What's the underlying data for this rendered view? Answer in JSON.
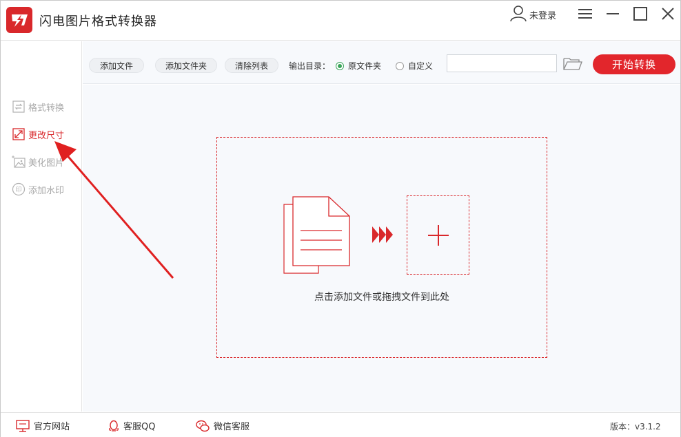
{
  "app": {
    "title": "闪电图片格式转换器"
  },
  "user": {
    "label": "未登录"
  },
  "sidebar": {
    "items": [
      {
        "label": "格式转换"
      },
      {
        "label": "更改尺寸"
      },
      {
        "label": "美化图片"
      },
      {
        "label": "添加水印"
      }
    ]
  },
  "toolbar": {
    "add_file": "添加文件",
    "add_folder": "添加文件夹",
    "clear_list": "清除列表",
    "output_label": "输出目录：",
    "option_original": "原文件夹",
    "option_custom": "自定义",
    "path_value": "",
    "start": "开始转换"
  },
  "main": {
    "drop_hint": "点击添加文件或拖拽文件到此处"
  },
  "footer": {
    "website": "官方网站",
    "qq": "客服QQ",
    "wechat": "微信客服",
    "version": "版本：v3.1.2"
  },
  "colors": {
    "accent": "#d9282b",
    "radio_checked": "#3aa55a",
    "background": "#f7f9fc"
  },
  "icons": [
    "logo-icon",
    "user-icon",
    "menu-icon",
    "minimize-icon",
    "maximize-icon",
    "close-icon",
    "convert-icon",
    "resize-icon",
    "beautify-icon",
    "watermark-icon",
    "folder-icon",
    "document-icon",
    "forward-arrows-icon",
    "plus-icon",
    "monitor-icon",
    "qq-icon",
    "wechat-icon"
  ]
}
